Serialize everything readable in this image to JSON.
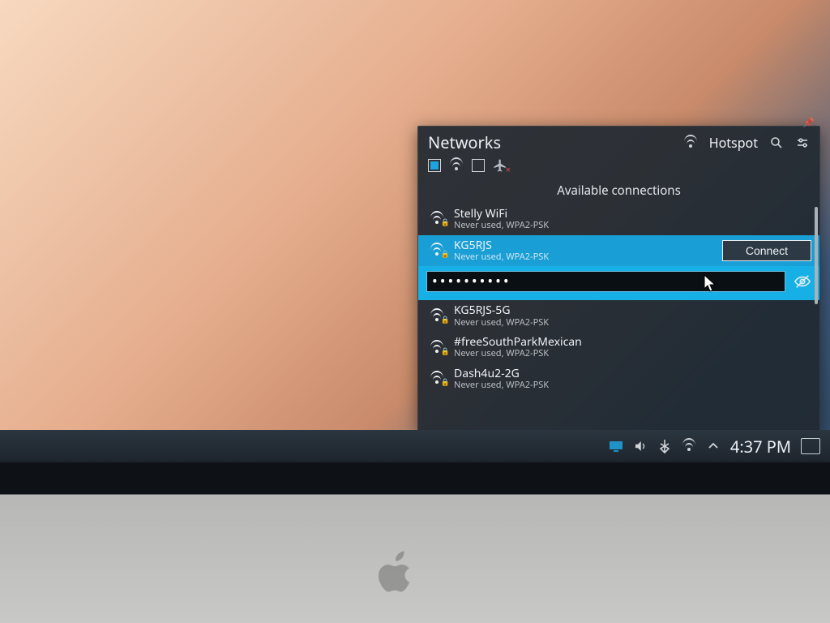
{
  "popup": {
    "title": "Networks",
    "hotspot_label": "Hotspot",
    "section_heading": "Available connections",
    "connect_label": "Connect",
    "password_mask": "●●●●●●●●●●",
    "networks": [
      {
        "ssid": "Stelly WiFi",
        "sub": "Never used, WPA2-PSK",
        "selected": false
      },
      {
        "ssid": "KG5RJS",
        "sub": "Never used, WPA2-PSK",
        "selected": true
      },
      {
        "ssid": "KG5RJS-5G",
        "sub": "Never used, WPA2-PSK",
        "selected": false
      },
      {
        "ssid": "#freeSouthParkMexican",
        "sub": "Never used, WPA2-PSK",
        "selected": false
      },
      {
        "ssid": "Dash4u2-2G",
        "sub": "Never used, WPA2-PSK",
        "selected": false
      }
    ]
  },
  "taskbar": {
    "clock": "4:37 PM"
  }
}
